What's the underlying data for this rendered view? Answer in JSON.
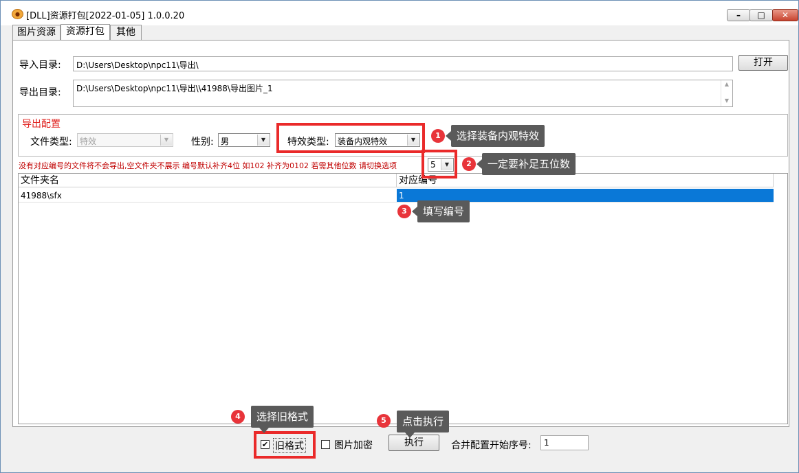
{
  "window": {
    "title": "[DLL]资源打包[2022-01-05] 1.0.0.20",
    "icon": "app-logo-icon"
  },
  "tabs": [
    {
      "label": "图片资源"
    },
    {
      "label": "资源打包"
    },
    {
      "label": "其他"
    }
  ],
  "import_dir": {
    "label": "导入目录:",
    "value": "D:\\Users\\Desktop\\npc11\\导出\\",
    "open_button": "打开"
  },
  "export_dir": {
    "label": "导出目录:",
    "value": "D:\\Users\\Desktop\\npc11\\导出\\\\41988\\导出图片_1"
  },
  "export_config": {
    "title": "导出配置",
    "file_type": {
      "label": "文件类型:",
      "value": "特效"
    },
    "gender": {
      "label": "性别:",
      "value": "男"
    },
    "effect_type": {
      "label": "特效类型:",
      "value": "装备内观特效"
    }
  },
  "hint": {
    "text": "没有对应编号的文件将不会导出,空文件夹不展示 编号默认补齐4位 如102 补齐为0102 若需其他位数 请切换选项",
    "digits": "5"
  },
  "table": {
    "columns": [
      "文件夹名",
      "对应编号"
    ],
    "rows": [
      {
        "folder": "41988\\sfx",
        "number": "1"
      }
    ]
  },
  "bottom": {
    "old_format": {
      "label": "旧格式",
      "checked": true
    },
    "encrypt": {
      "label": "图片加密",
      "checked": false
    },
    "execute_button": "执行",
    "merge_start": {
      "label": "合并配置开始序号:",
      "value": "1"
    }
  },
  "annotations": [
    {
      "n": "1",
      "text": "选择装备内观特效"
    },
    {
      "n": "2",
      "text": "一定要补足五位数"
    },
    {
      "n": "3",
      "text": "填写编号"
    },
    {
      "n": "4",
      "text": "选择旧格式"
    },
    {
      "n": "5",
      "text": "点击执行"
    }
  ],
  "colors": {
    "highlight": "#ea2a2a",
    "selection": "#0a78d7",
    "hint_text": "#c00000"
  }
}
